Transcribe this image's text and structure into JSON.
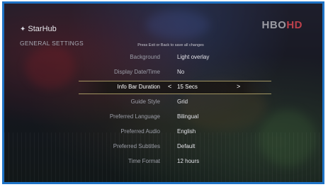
{
  "brand": {
    "name": "StarHub",
    "channel_logo": "HBO",
    "channel_logo_suffix": "HD"
  },
  "section_title": "GENERAL SETTINGS",
  "hint": "Press Exit or Back to save all changes",
  "settings": [
    {
      "label": "Background",
      "value": "Light overlay"
    },
    {
      "label": "Display Date/Time",
      "value": "No"
    },
    {
      "label": "Info Bar Duration",
      "value": "15 Secs"
    },
    {
      "label": "Guide Style",
      "value": "Grid"
    },
    {
      "label": "Preferred Language",
      "value": "Bilingual"
    },
    {
      "label": "Preferred Audio",
      "value": "English"
    },
    {
      "label": "Preferred Subtitles",
      "value": "Default"
    },
    {
      "label": "Time Format",
      "value": "12 hours"
    }
  ],
  "selected_index": 2,
  "arrows": {
    "left": "<",
    "right": ">"
  },
  "colors": {
    "frame": "#1e73c6",
    "highlight_border": "#cdbe78"
  }
}
